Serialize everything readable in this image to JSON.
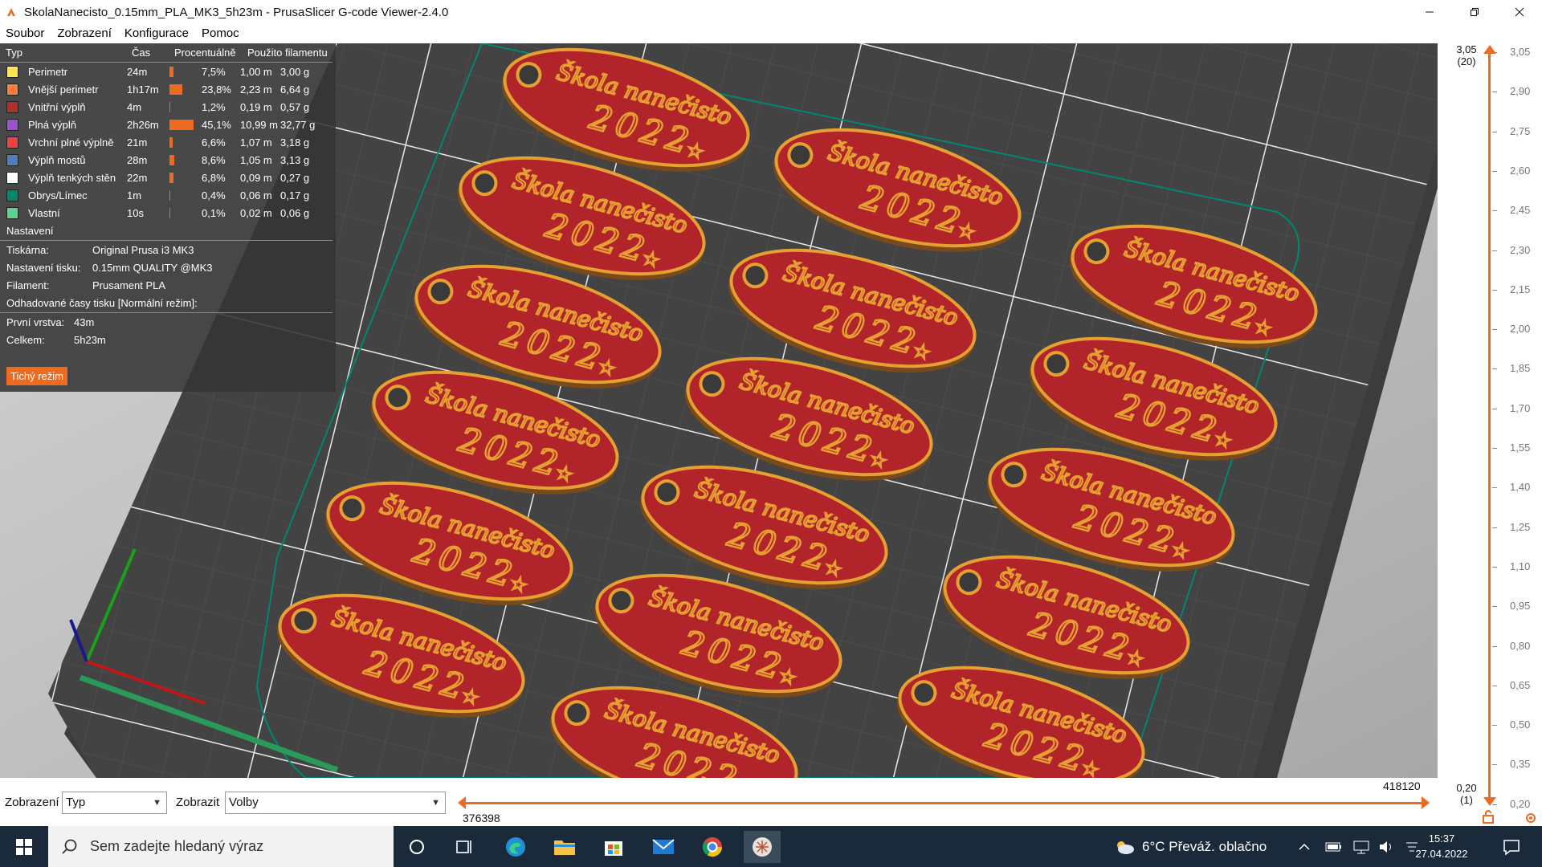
{
  "window": {
    "title": "SkolaNanecisto_0.15mm_PLA_MK3_5h23m - PrusaSlicer G-code Viewer-2.4.0"
  },
  "menu": [
    "Soubor",
    "Zobrazení",
    "Konfigurace",
    "Pomoc"
  ],
  "legend": {
    "headers": {
      "type": "Typ",
      "time": "Čas",
      "percent": "Procentuálně",
      "filament": "Použito filamentu"
    },
    "rows": [
      {
        "label": "Perimetr",
        "time": "24m",
        "percent": "7,5%",
        "pct_value": 7.5,
        "length": "1,00 m",
        "weight": "3,00 g",
        "color": "#ffe64d"
      },
      {
        "label": "Vnější perimetr",
        "time": "1h17m",
        "percent": "23,8%",
        "pct_value": 23.8,
        "length": "2,23 m",
        "weight": "6,64 g",
        "color": "#ff7d38"
      },
      {
        "label": "Vnitřní výplň",
        "time": "4m",
        "percent": "1,2%",
        "pct_value": 1.2,
        "length": "0,19 m",
        "weight": "0,57 g",
        "color": "#b0302c"
      },
      {
        "label": "Plná výplň",
        "time": "2h26m",
        "percent": "45,1%",
        "pct_value": 45.1,
        "length": "10,99 m",
        "weight": "32,77 g",
        "color": "#9654cc"
      },
      {
        "label": "Vrchní plné výplně",
        "time": "21m",
        "percent": "6,6%",
        "pct_value": 6.6,
        "length": "1,07 m",
        "weight": "3,18 g",
        "color": "#f04040"
      },
      {
        "label": "Výplň mostů",
        "time": "28m",
        "percent": "8,6%",
        "pct_value": 8.6,
        "length": "1,05 m",
        "weight": "3,13 g",
        "color": "#4d80ba"
      },
      {
        "label": "Výplň tenkých stěn",
        "time": "22m",
        "percent": "6,8%",
        "pct_value": 6.8,
        "length": "0,09 m",
        "weight": "0,27 g",
        "color": "#ffffff"
      },
      {
        "label": "Obrys/Límec",
        "time": "1m",
        "percent": "0,4%",
        "pct_value": 0.4,
        "length": "0,06 m",
        "weight": "0,17 g",
        "color": "#00876e"
      },
      {
        "label": "Vlastní",
        "time": "10s",
        "percent": "0,1%",
        "pct_value": 0.1,
        "length": "0,02 m",
        "weight": "0,06 g",
        "color": "#5ed194"
      }
    ],
    "settings_title": "Nastavení",
    "printer_label": "Tiskárna:",
    "printer_value": "Original Prusa i3 MK3",
    "print_label": "Nastavení tisku:",
    "print_value": "0.15mm QUALITY @MK3",
    "filament_label": "Filament:",
    "filament_value": "Prusament PLA",
    "estimates_title": "Odhadované časy tisku [Normální režim]:",
    "first_layer_label": "První vrstva:",
    "first_layer_value": "43m",
    "total_label": "Celkem:",
    "total_value": "5h23m",
    "quiet_button": "Tichý režim"
  },
  "layer_slider": {
    "top_value": "3,05",
    "top_layer": "(20)",
    "bottom_value": "0,20",
    "bottom_layer": "(1)",
    "ticks": [
      "3,05",
      "2,90",
      "2,75",
      "2,60",
      "2,45",
      "2,30",
      "2,15",
      "2,00",
      "1,85",
      "1,70",
      "1,55",
      "1,40",
      "1,25",
      "1,10",
      "0,95",
      "0,80",
      "0,65",
      "0,50",
      "0,35",
      "0,20"
    ]
  },
  "bottom_bar": {
    "view_label": "Zobrazení",
    "view_value": "Typ",
    "show_label": "Zobrazit",
    "show_value": "Volby",
    "move_max": "418120",
    "move_min": "376398"
  },
  "keychain": {
    "text_line1": "Škola nanečisto",
    "text_line2": "2022"
  },
  "taskbar": {
    "search_placeholder": "Sem zadejte hledaný výraz",
    "weather": "6°C  Převáž. oblačno",
    "time": "15:37",
    "date": "27.04.2022"
  },
  "colors": {
    "accent": "#ed6b21",
    "tag_fill": "#b0242a",
    "tag_rim": "#e6a032",
    "bed": "#3c3c3c"
  }
}
